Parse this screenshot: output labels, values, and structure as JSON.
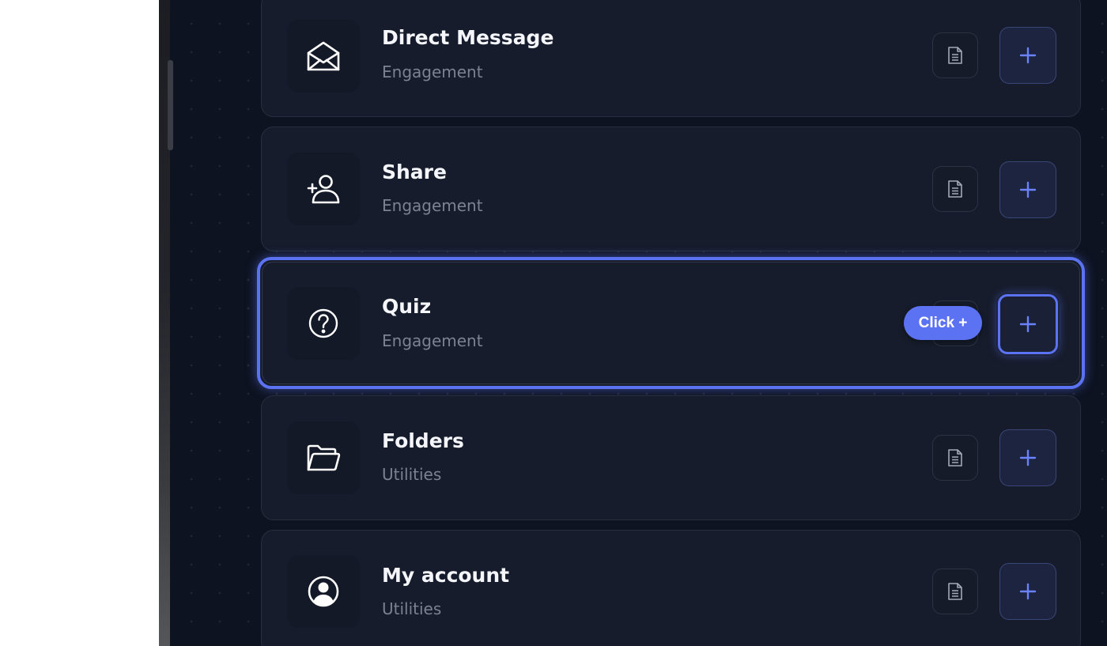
{
  "items": [
    {
      "title": "Direct Message",
      "category": "Engagement",
      "icon": "envelope-open-icon"
    },
    {
      "title": "Share",
      "category": "Engagement",
      "icon": "user-add-icon"
    },
    {
      "title": "Quiz",
      "category": "Engagement",
      "icon": "question-circle-icon"
    },
    {
      "title": "Folders",
      "category": "Utilities",
      "icon": "folder-open-icon"
    },
    {
      "title": "My account",
      "category": "Utilities",
      "icon": "user-circle-icon"
    }
  ],
  "hint": {
    "label": "Click +"
  },
  "colors": {
    "background": "#0d1320",
    "card": "#161c2b",
    "accent": "#5b72f2",
    "title": "#f4f6fb",
    "subtitle": "#7b8294"
  },
  "highlighted_item": "Quiz"
}
